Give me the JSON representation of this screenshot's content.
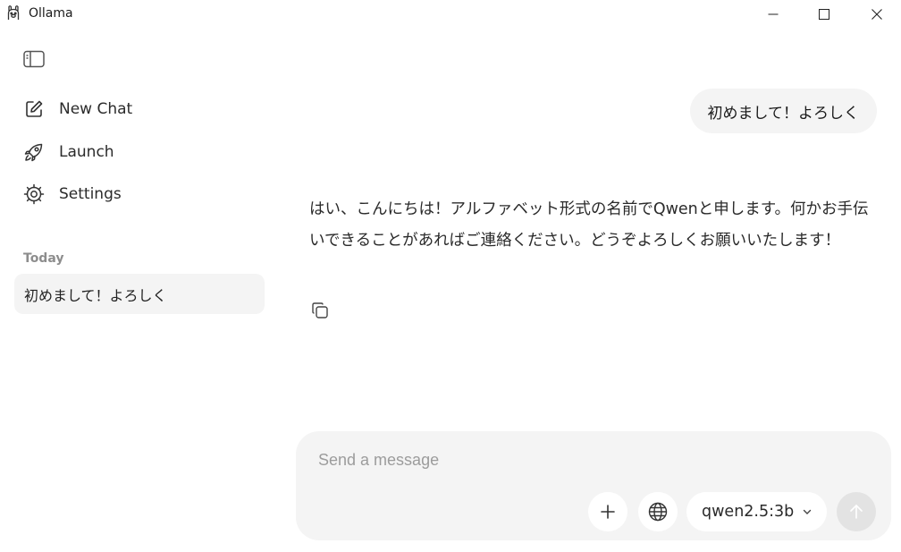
{
  "window": {
    "title": "Ollama",
    "controls": [
      "minimize",
      "maximize",
      "close"
    ]
  },
  "sidebar": {
    "toggle_icon": "sidebar-toggle-icon",
    "nav": [
      {
        "label": "New Chat",
        "icon": "edit-icon"
      },
      {
        "label": "Launch",
        "icon": "rocket-icon"
      },
      {
        "label": "Settings",
        "icon": "gear-icon"
      }
    ],
    "history_section": "Today",
    "history": [
      {
        "title": "初めまして！よろしく"
      }
    ]
  },
  "conversation": {
    "user_message": "初めまして！よろしく",
    "assistant_message": "はい、こんにちは！アルファベット形式の名前でQwenと申します。何かお手伝いできることがあればご連絡ください。どうぞよろしくお願いいたします！"
  },
  "composer": {
    "placeholder": "Send a message",
    "value": "",
    "model": "qwen2.5:3b"
  },
  "colors": {
    "background": "#ffffff",
    "bubble": "#f4f4f4",
    "send_disabled": "#e3e3e3",
    "muted_text": "#8d8d8d"
  }
}
